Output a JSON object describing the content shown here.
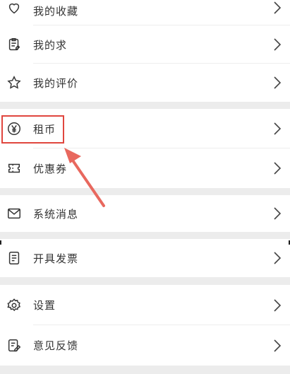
{
  "menu": {
    "group1": [
      {
        "label": "我的收藏",
        "icon": "heart-icon"
      },
      {
        "label": "我的求",
        "icon": "clipboard-icon"
      },
      {
        "label": "我的评价",
        "icon": "star-icon"
      }
    ],
    "group2": [
      {
        "label": "租币",
        "icon": "yen-icon"
      },
      {
        "label": "优惠券",
        "icon": "ticket-icon"
      }
    ],
    "group3": [
      {
        "label": "系统消息",
        "icon": "mail-icon"
      }
    ],
    "group4": [
      {
        "label": "开具发票",
        "icon": "document-icon"
      }
    ],
    "group5": [
      {
        "label": "设置",
        "icon": "gear-icon"
      },
      {
        "label": "意见反馈",
        "icon": "feedback-edit-icon"
      }
    ]
  },
  "colors": {
    "highlight": "#e0463e",
    "arrow": "#e8685e",
    "background": "#ececec",
    "row": "#ffffff"
  }
}
